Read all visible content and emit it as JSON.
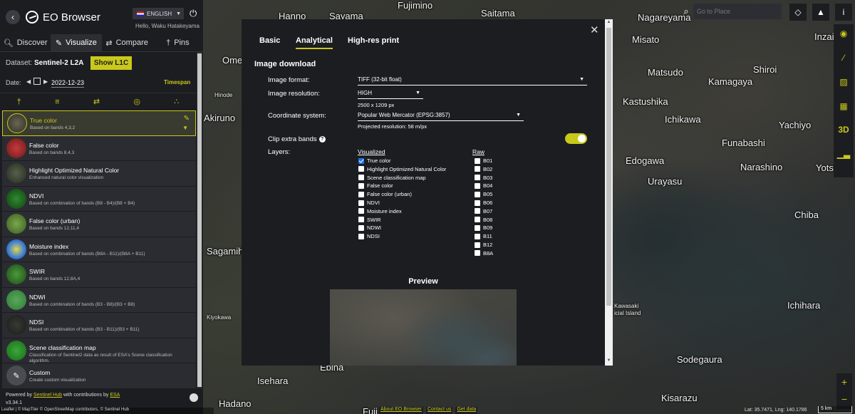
{
  "app": {
    "title": "EO Browser",
    "language": "ENGLISH",
    "greeting": "Hello, Waku Hatakeyama"
  },
  "tabs": [
    {
      "label": "Discover"
    },
    {
      "label": "Visualize"
    },
    {
      "label": "Compare"
    },
    {
      "label": "Pins"
    }
  ],
  "dataset": {
    "label": "Dataset:",
    "value": "Sentinel-2 L2A",
    "toggle_button": "Show L1C"
  },
  "date": {
    "label": "Date:",
    "value": "2022-12-23",
    "timespan": "Timespan"
  },
  "layers": [
    {
      "name": "True color",
      "desc": "Based on bands 4,3,2",
      "active": true
    },
    {
      "name": "False color",
      "desc": "Based on bands 8,4,3"
    },
    {
      "name": "Highlight Optimized Natural Color",
      "desc": "Enhanced natural color visualization"
    },
    {
      "name": "NDVI",
      "desc": "Based on combination of bands (B8 - B4)/(B8 + B4)"
    },
    {
      "name": "False color (urban)",
      "desc": "Based on bands 12,11,4"
    },
    {
      "name": "Moisture index",
      "desc": "Based on combination of bands (B8A - B11)/(B8A + B11)"
    },
    {
      "name": "SWIR",
      "desc": "Based on bands 12,8A,4"
    },
    {
      "name": "NDWI",
      "desc": "Based on combination of bands (B3 - B8)/(B3 + B8)"
    },
    {
      "name": "NDSI",
      "desc": "Based on combination of bands (B3 - B11)/(B3 + B11)"
    },
    {
      "name": "Scene classification map",
      "desc": "Classification of Sentinel2 data as result of ESA's Scene classification algorithm."
    },
    {
      "name": "Custom",
      "desc": "Create custom visualization"
    }
  ],
  "footer": {
    "powered_prefix": "Powered by",
    "powered_link1": "Sentinel Hub",
    "powered_mid": "with contributions by",
    "powered_link2": "ESA",
    "version": "v3.34.1"
  },
  "search": {
    "placeholder": "Go to Place"
  },
  "map_labels": [
    {
      "text": "Hanno"
    },
    {
      "text": "Sayama"
    },
    {
      "text": "Fujimino"
    },
    {
      "text": "Saitama"
    },
    {
      "text": "Nagareyama"
    },
    {
      "text": "Inzai"
    },
    {
      "text": "Misato"
    },
    {
      "text": "Ome"
    },
    {
      "text": "Matsudo"
    },
    {
      "text": "Shiroi"
    },
    {
      "text": "Kamagaya"
    },
    {
      "text": "Hinode"
    },
    {
      "text": "Kastushika"
    },
    {
      "text": "Ichikawa"
    },
    {
      "text": "Yachiyo"
    },
    {
      "text": "Akiruno"
    },
    {
      "text": "Funabashi"
    },
    {
      "text": "Edogawa"
    },
    {
      "text": "Narashino"
    },
    {
      "text": "Yots"
    },
    {
      "text": "Urayasu"
    },
    {
      "text": "Chiba"
    },
    {
      "text": "Sagamih"
    },
    {
      "text": "Kiyokawa"
    },
    {
      "text": "Kawasaki"
    },
    {
      "text": "icial Island"
    },
    {
      "text": "Ichihara"
    },
    {
      "text": "Sodegaura"
    },
    {
      "text": "Isehara"
    },
    {
      "text": "Ebina"
    },
    {
      "text": "Kisarazu"
    },
    {
      "text": "Hadano"
    },
    {
      "text": "Fuji"
    }
  ],
  "bottom": {
    "attribution": "Leaflet | © MapTiler © OpenStreetMap contributors, © Sentinel Hub",
    "links": [
      "About EO Browser",
      "Contact us",
      "Get data"
    ],
    "coords": "Lat: 35.7471, Lng: 140.1786",
    "scale": "5 km"
  },
  "vbar_3d": "3D",
  "modal": {
    "tabs": [
      "Basic",
      "Analytical",
      "High-res print"
    ],
    "active_tab": "Analytical",
    "title": "Image download",
    "format_label": "Image format:",
    "format_value": "TIFF (32-bit float)",
    "resolution_label": "Image resolution:",
    "resolution_value": "HIGH",
    "resolution_px": "2500 x 1209 px",
    "crs_label": "Coordinate system:",
    "crs_value": "Popular Web Mercator (EPSG:3857)",
    "crs_res": "Projected resolution: 58 m/px",
    "clip_label": "Clip extra bands",
    "clip_enabled": true,
    "layers_label": "Layers:",
    "visualized_head": "Visualized",
    "raw_head": "Raw",
    "visualized": [
      {
        "label": "True color",
        "checked": true
      },
      {
        "label": "Highlight Optimized Natural Color",
        "checked": false
      },
      {
        "label": "Scene classification map",
        "checked": false
      },
      {
        "label": "False color",
        "checked": false
      },
      {
        "label": "False color (urban)",
        "checked": false
      },
      {
        "label": "NDVI",
        "checked": false
      },
      {
        "label": "Moisture index",
        "checked": false
      },
      {
        "label": "SWIR",
        "checked": false
      },
      {
        "label": "NDWI",
        "checked": false
      },
      {
        "label": "NDSI",
        "checked": false
      }
    ],
    "raw": [
      {
        "label": "B01"
      },
      {
        "label": "B02"
      },
      {
        "label": "B03"
      },
      {
        "label": "B04"
      },
      {
        "label": "B05"
      },
      {
        "label": "B06"
      },
      {
        "label": "B07"
      },
      {
        "label": "B08"
      },
      {
        "label": "B09"
      },
      {
        "label": "B11"
      },
      {
        "label": "B12"
      },
      {
        "label": "B8A"
      }
    ],
    "preview_title": "Preview"
  }
}
